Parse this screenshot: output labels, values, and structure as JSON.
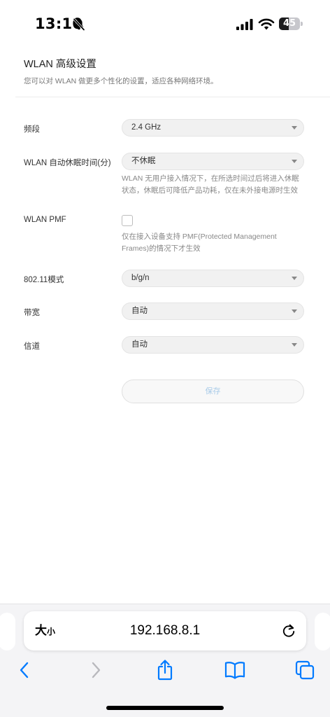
{
  "status_bar": {
    "time": "13:10",
    "battery_level": "45",
    "battery_fraction": 0.45,
    "icons": [
      "bell-slash-icon",
      "cellular-signal-icon",
      "wifi-icon",
      "battery-icon"
    ]
  },
  "page": {
    "title": "WLAN 高级设置",
    "description": "您可以对 WLAN 做更多个性化的设置，适应各种网络环境。"
  },
  "fields": {
    "band": {
      "label": "频段",
      "value": "2.4 GHz"
    },
    "sleep": {
      "label": "WLAN 自动休眠时间(分)",
      "value": "不休眠",
      "hint_line1": "WLAN 无用户接入情况下，在所选时间过后将进入休眠",
      "hint_line2": "状态，休眠后可降低产品功耗，仅在未外接电源时生效"
    },
    "pmf": {
      "label": "WLAN PMF",
      "checked": false,
      "hint_line1": "仅在接入设备支持 PMF(Protected Management",
      "hint_line2": "Frames)的情况下才生效"
    },
    "mode": {
      "label": "802.11模式",
      "value": "b/g/n"
    },
    "bandwidth": {
      "label": "带宽",
      "value": "自动"
    },
    "channel": {
      "label": "信道",
      "value": "自动"
    }
  },
  "save_label": "保存",
  "browser": {
    "text_size_big": "大",
    "text_size_small": "小",
    "url": "192.168.8.1",
    "toolbar_icons": [
      "back-icon",
      "forward-icon",
      "share-icon",
      "bookmarks-icon",
      "tabs-icon"
    ]
  },
  "colors": {
    "accent": "#007aff",
    "save_text": "#a9cbe8",
    "forward_disabled": "#b8b8bd"
  }
}
